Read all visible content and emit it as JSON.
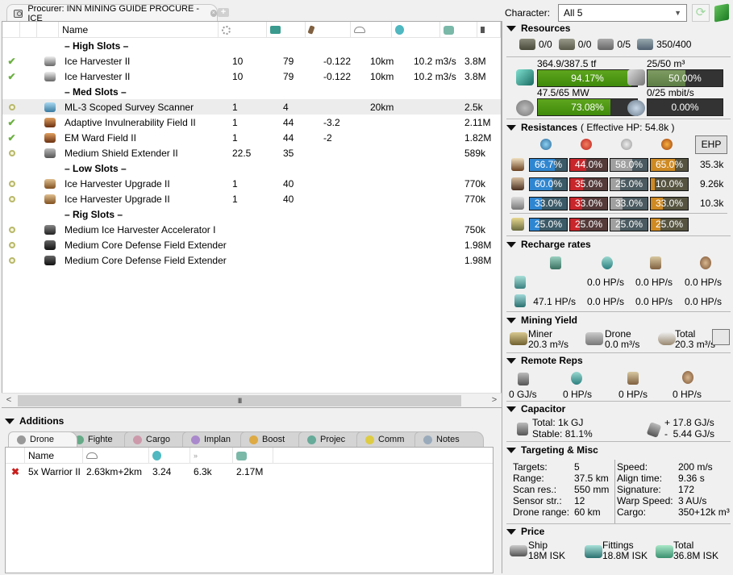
{
  "window": {
    "fit_tab_title": "Procurer: INN MINING GUIDE PROCURE - ICE",
    "close_tab_icon": "close-circle-icon",
    "add_tab_icon": "plus-icon"
  },
  "fitting_list": {
    "columns": [
      "",
      "",
      "",
      "Name",
      "cpu-icon",
      "powergrid-icon",
      "capacitor-icon",
      "optimal-range-icon",
      "mining-yield-icon",
      "price-icon",
      "more"
    ],
    "header_name": "Name",
    "rows": [
      {
        "type": "header",
        "name": "– High Slots –"
      },
      {
        "type": "module",
        "state": "active",
        "icon": "ice-harvester-icon",
        "name": "Ice Harvester II",
        "cpu": "10",
        "pg": "79",
        "cap": "-0.122",
        "range": "10km",
        "misc": "10.2 m3/s",
        "price": "3.8M"
      },
      {
        "type": "module",
        "state": "active",
        "icon": "ice-harvester-icon",
        "name": "Ice Harvester II",
        "cpu": "10",
        "pg": "79",
        "cap": "-0.122",
        "range": "10km",
        "misc": "10.2 m3/s",
        "price": "3.8M"
      },
      {
        "type": "header",
        "name": "– Med Slots –"
      },
      {
        "type": "module",
        "state": "online",
        "icon": "survey-scanner-icon",
        "name": "ML-3 Scoped Survey Scanner",
        "cpu": "1",
        "pg": "4",
        "cap": "",
        "range": "20km",
        "misc": "",
        "price": "2.5k",
        "selected": true
      },
      {
        "type": "module",
        "state": "active",
        "icon": "shield-hardener-icon",
        "name": "Adaptive Invulnerability Field II",
        "cpu": "1",
        "pg": "44",
        "cap": "-3.2",
        "range": "",
        "misc": "",
        "price": "2.11M"
      },
      {
        "type": "module",
        "state": "active",
        "icon": "shield-hardener-icon",
        "name": "EM Ward Field II",
        "cpu": "1",
        "pg": "44",
        "cap": "-2",
        "range": "",
        "misc": "",
        "price": "1.82M"
      },
      {
        "type": "module",
        "state": "online",
        "icon": "shield-extender-icon",
        "name": "Medium Shield Extender II",
        "cpu": "22.5",
        "pg": "35",
        "cap": "",
        "range": "",
        "misc": "",
        "price": "589k"
      },
      {
        "type": "header",
        "name": "– Low Slots –"
      },
      {
        "type": "module",
        "state": "online",
        "icon": "harvester-upgrade-icon",
        "name": "Ice Harvester Upgrade II",
        "cpu": "1",
        "pg": "40",
        "cap": "",
        "range": "",
        "misc": "",
        "price": "770k"
      },
      {
        "type": "module",
        "state": "online",
        "icon": "harvester-upgrade-icon",
        "name": "Ice Harvester Upgrade II",
        "cpu": "1",
        "pg": "40",
        "cap": "",
        "range": "",
        "misc": "",
        "price": "770k"
      },
      {
        "type": "header",
        "name": "– Rig Slots –"
      },
      {
        "type": "module",
        "state": "online",
        "icon": "rig-icon",
        "name": "Medium Ice Harvester Accelerator I",
        "cpu": "",
        "pg": "",
        "cap": "",
        "range": "",
        "misc": "",
        "price": "750k"
      },
      {
        "type": "module",
        "state": "online",
        "icon": "rig-shield-icon",
        "name": "Medium Core Defense Field Extender I",
        "cpu": "",
        "pg": "",
        "cap": "",
        "range": "",
        "misc": "",
        "price": "1.98M"
      },
      {
        "type": "module",
        "state": "online",
        "icon": "rig-shield-icon",
        "name": "Medium Core Defense Field Extender I",
        "cpu": "",
        "pg": "",
        "cap": "",
        "range": "",
        "misc": "",
        "price": "1.98M"
      }
    ],
    "scrollbar": {
      "left": "<",
      "right": ">",
      "grip": "III"
    }
  },
  "additions": {
    "title": "Additions",
    "tabs": [
      {
        "label": "Drone",
        "icon": "drone-icon",
        "active": true
      },
      {
        "label": "Fighte",
        "icon": "fighter-icon"
      },
      {
        "label": "Cargo",
        "icon": "cargo-icon"
      },
      {
        "label": "Implan",
        "icon": "implant-icon"
      },
      {
        "label": "Boost",
        "icon": "booster-icon"
      },
      {
        "label": "Projec",
        "icon": "projected-icon"
      },
      {
        "label": "Comm",
        "icon": "command-icon"
      },
      {
        "label": "Notes",
        "icon": "notes-icon"
      }
    ],
    "drone_columns": {
      "name": "Name",
      "range_icon": "range-icon",
      "dps_icon": "dps-icon",
      "speed_icon": "speed-icon",
      "price_icon": "price-icon"
    },
    "drones": [
      {
        "state": "inactive",
        "name": "5x Warrior II",
        "range": "2.63km+2km",
        "dps": "3.24",
        "speed": "6.3k",
        "price": "2.17M"
      }
    ]
  },
  "stats": {
    "character_label": "Character:",
    "character_value": "All 5",
    "resources": {
      "title": "Resources",
      "turrets": "0/0",
      "launchers": "0/0",
      "drones_active": "0/5",
      "calibration": "350/400",
      "cpu": {
        "label": "364.9/387.5 tf",
        "percent_text": "94.17%",
        "fraction": 0.9417
      },
      "drone_bay": {
        "label": "25/50 m³",
        "percent_text": "50.00%",
        "fraction": 0.5
      },
      "powergrid": {
        "label": "47.5/65 MW",
        "percent_text": "73.08%",
        "fraction": 0.7308
      },
      "bandwidth": {
        "label": "0/25 mbit/s",
        "percent_text": "0.00%",
        "fraction": 0
      }
    },
    "resistances": {
      "title": "Resistances",
      "subtitle": "( Effective HP: 54.8k )",
      "ehp_button": "EHP",
      "rows": [
        {
          "layer": "shield",
          "em": 66.7,
          "thermal": 44.0,
          "kinetic": 58.0,
          "explosive": 65.0,
          "em_text": "66.7%",
          "th_text": "44.0%",
          "ki_text": "58.0%",
          "ex_text": "65.0%",
          "ehp": "35.3k"
        },
        {
          "layer": "armor",
          "em": 60.0,
          "thermal": 35.0,
          "kinetic": 25.0,
          "explosive": 10.0,
          "em_text": "60.0%",
          "th_text": "35.0%",
          "ki_text": "25.0%",
          "ex_text": "10.0%",
          "ehp": "9.26k"
        },
        {
          "layer": "hull",
          "em": 33.0,
          "thermal": 33.0,
          "kinetic": 33.0,
          "explosive": 33.0,
          "em_text": "33.0%",
          "th_text": "33.0%",
          "ki_text": "33.0%",
          "ex_text": "33.0%",
          "ehp": "10.3k"
        },
        {
          "layer": "damage-pattern",
          "em": 25.0,
          "thermal": 25.0,
          "kinetic": 25.0,
          "explosive": 25.0,
          "em_text": "25.0%",
          "th_text": "25.0%",
          "ki_text": "25.0%",
          "ex_text": "25.0%",
          "ehp": ""
        }
      ]
    },
    "recharge": {
      "title": "Recharge rates",
      "row_reinforced": {
        "shield": "",
        "armor": "0.0 HP/s",
        "hull": "0.0 HP/s",
        "total": "0.0 HP/s"
      },
      "row_sustained": {
        "shield": "47.1 HP/s",
        "armor": "0.0 HP/s",
        "hull": "0.0 HP/s",
        "total": "0.0 HP/s"
      }
    },
    "mining": {
      "title": "Mining Yield",
      "miner_label": "Miner",
      "miner_value": "20.3 m³/s",
      "drone_label": "Drone",
      "drone_value": "0.0 m³/s",
      "total_label": "Total",
      "total_value": "20.3 m³/s"
    },
    "remote_reps": {
      "title": "Remote Reps",
      "cap": "0 GJ/s",
      "shield": "0 HP/s",
      "armor": "0 HP/s",
      "hull": "0 HP/s"
    },
    "capacitor": {
      "title": "Capacitor",
      "total": "Total: 1k GJ",
      "stable": "Stable: 81.1%",
      "gain": "+ 17.8 GJ/s",
      "use": "-  5.44 GJ/s"
    },
    "targeting": {
      "title": "Targeting & Misc",
      "left": [
        {
          "k": "Targets:",
          "v": "5"
        },
        {
          "k": "Range:",
          "v": "37.5 km"
        },
        {
          "k": "Scan res.:",
          "v": "550 mm"
        },
        {
          "k": "Sensor str.:",
          "v": "12"
        },
        {
          "k": "Drone range:",
          "v": "60 km"
        }
      ],
      "right": [
        {
          "k": "Speed:",
          "v": "200 m/s"
        },
        {
          "k": "Align time:",
          "v": "9.36 s"
        },
        {
          "k": "Signature:",
          "v": "172"
        },
        {
          "k": "Warp Speed:",
          "v": "3 AU/s"
        },
        {
          "k": "Cargo:",
          "v": "350+12k m³"
        }
      ]
    },
    "price": {
      "title": "Price",
      "ship_label": "Ship",
      "ship_value": "18M ISK",
      "fittings_label": "Fittings",
      "fittings_value": "18.8M ISK",
      "total_label": "Total",
      "total_value": "36.8M ISK"
    }
  }
}
